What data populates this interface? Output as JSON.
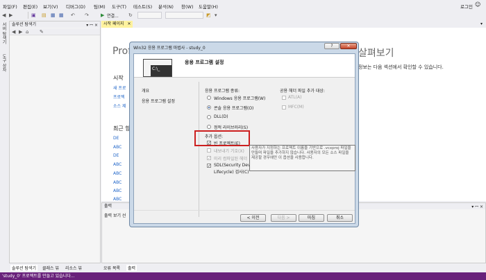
{
  "menu": {
    "items": [
      "파일(F)",
      "편집(E)",
      "보기(V)",
      "디버그(D)",
      "팀(M)",
      "도구(T)",
      "테스트(S)",
      "분석(N)",
      "창(W)",
      "도움말(H)"
    ],
    "login": "로그인"
  },
  "toolbar": {
    "start_label": "연결..."
  },
  "side_tabs": [
    "서버 탐색기",
    "도구 상자"
  ],
  "solution_explorer": {
    "title": "솔루션 탐색기",
    "pin": "▾ ꟷ ×",
    "bottom_tabs": [
      "솔루션 탐색기",
      "클래스 뷰",
      "리소스 뷰"
    ]
  },
  "editor": {
    "tab_label": "시작 페이지",
    "heading_left": "Prof",
    "heading_right": "살펴보기",
    "desc": "정보는 다음 섹션에서 확인할 수 있습니다.",
    "start_title": "시작",
    "start_links": [
      "새 프로",
      "프로젝",
      "소스 제"
    ],
    "recent_title": "최근 항",
    "recent_items": [
      "DE",
      "ABC",
      "DE",
      "ABC",
      "ABC",
      "ABC",
      "ABC",
      "ABC"
    ]
  },
  "output_panel": {
    "title": "출력",
    "source_label": "출력 보기 선",
    "bottom_tabs": [
      "오류 목록",
      "출력"
    ]
  },
  "status_bar": {
    "text": "'study_0' 프로젝트를 만들고 있습니다..."
  },
  "dialog": {
    "title": "Win32 응용 프로그램 마법사 - study_0",
    "help": "?",
    "close": "✕",
    "header": "응용 프로그램 설정",
    "icon_text": "C:\\_",
    "nav": [
      "개요",
      "응용 프로그램 설정"
    ],
    "app_type_label": "응용 프로그램 종류:",
    "app_types": [
      {
        "label": "Windows 응용 프로그램(W)",
        "checked": false
      },
      {
        "label": "콘솔 응용 프로그램(O)",
        "checked": true
      },
      {
        "label": "DLL(D)",
        "checked": false
      },
      {
        "label": "정적 라이브러리(S)",
        "checked": false
      }
    ],
    "header_files_label": "공용 헤더 파일 추가 대상:",
    "header_files": [
      "ATL(A)",
      "MFC(M)"
    ],
    "extra_options_label": "추가 옵션:",
    "empty_project": "빈 프로젝트(E)",
    "export_symbols": "내보내기 기호(X)",
    "precompiled": "미리 컴파일된 헤더",
    "sdl_line1": "SDL(Security Deve",
    "sdl_line2": "Lifecycle) 검사(C)",
    "tooltip": "사용자가 지정하는 프로젝트 이름을 기반으로 .vcxproj 파일을 만들며 파일을 추가하지 않습니다. 사용자의 모든 소스 파일을 제공할 경우에만 이 옵션을 사용합니다.",
    "buttons": {
      "prev": "< 이전",
      "next": "다음 >",
      "finish": "마침",
      "cancel": "취소"
    },
    "highlight_color": "#cc1f1f"
  }
}
